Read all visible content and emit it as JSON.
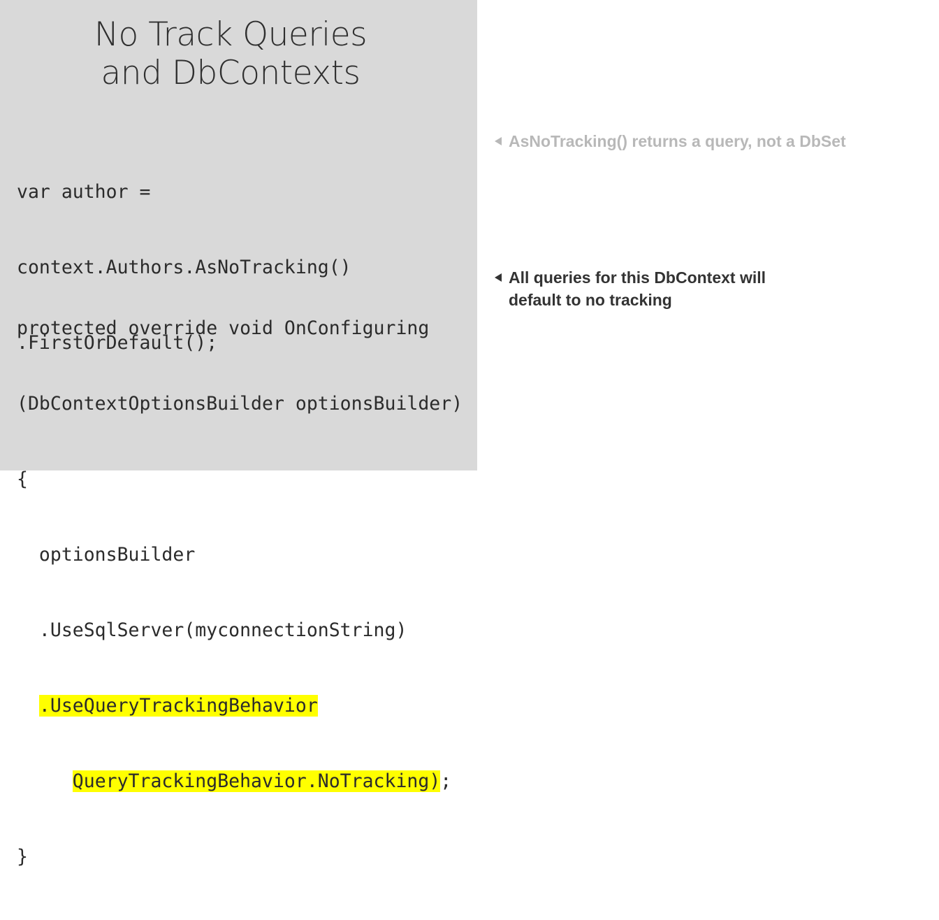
{
  "slide": {
    "title_line1": "No Track Queries",
    "title_line2": "and DbContexts",
    "code_block_1": [
      "var author =",
      "context.Authors.AsNoTracking()",
      ".FirstOrDefault();"
    ],
    "code_block_2": {
      "line1": "protected override void OnConfiguring",
      "line2": "(DbContextOptionsBuilder optionsBuilder)",
      "line3": "{",
      "line4": "  optionsBuilder",
      "line5": "  .UseSqlServer(myconnectionString)",
      "line6_prefix": "  ",
      "line6_highlight": ".UseQueryTrackingBehavior",
      "line7_prefix": "     ",
      "line7_highlight": "QueryTrackingBehavior.NoTracking)",
      "line7_suffix": ";",
      "line8": "}"
    },
    "note_1": "AsNoTracking() returns a query, not a DbSet",
    "note_2_line1": "All queries for this DbContext will",
    "note_2_line2": "default to no tracking"
  },
  "colors": {
    "left_panel": "#d9d9d9",
    "highlight": "#ffff00",
    "note_muted": "#b8b8b8",
    "note_active": "#333333"
  },
  "icons": [
    "left-triangle-arrow-icon"
  ]
}
